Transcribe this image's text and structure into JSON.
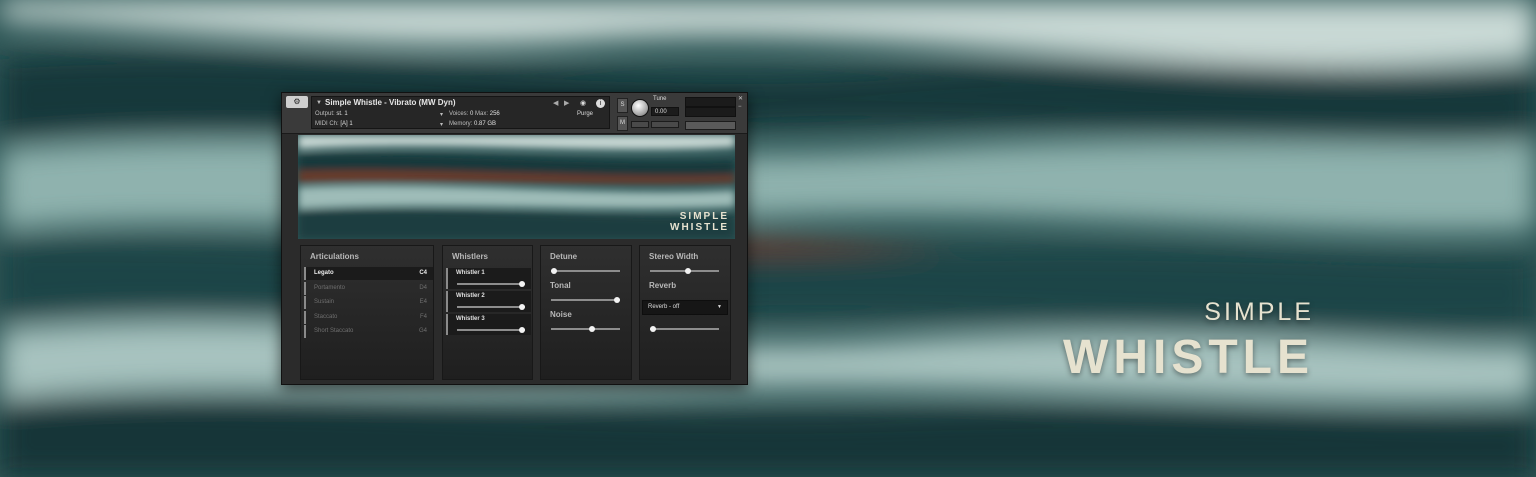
{
  "hero": {
    "line1": "SIMPLE",
    "line2": "WHISTLE"
  },
  "header": {
    "instrument_name": "Simple Whistle - Vibrato (MW Dyn)",
    "output_label": "Output:",
    "output_value": "st. 1",
    "midi_label": "MIDI Ch:",
    "midi_port": "[A]",
    "midi_value": "1",
    "voices_label": "Voices:",
    "voices_value": "0",
    "max_label": "Max:",
    "max_value": "256",
    "memory_label": "Memory:",
    "memory_value": "0.87 GB",
    "purge_label": "Purge",
    "tune_label": "Tune",
    "tune_value": "0.00",
    "s_label": "S",
    "m_label": "M"
  },
  "banner": {
    "line1": "SIMPLE",
    "line2": "WHISTLE"
  },
  "articulations": {
    "title": "Articulations",
    "items": [
      {
        "label": "Legato",
        "key": "C4",
        "selected": true
      },
      {
        "label": "Portamento",
        "key": "D4",
        "selected": false
      },
      {
        "label": "Sustain",
        "key": "E4",
        "selected": false
      },
      {
        "label": "Staccato",
        "key": "F4",
        "selected": false
      },
      {
        "label": "Short Staccato",
        "key": "G4",
        "selected": false
      }
    ]
  },
  "whistlers": {
    "title": "Whistlers",
    "items": [
      {
        "label": "Whistler 1",
        "value": 1.0
      },
      {
        "label": "Whistler 2",
        "value": 1.0
      },
      {
        "label": "Whistler 3",
        "value": 1.0
      }
    ]
  },
  "tone": {
    "detune_label": "Detune",
    "detune_value": 0.0,
    "tonal_label": "Tonal",
    "tonal_value": 1.0,
    "noise_label": "Noise",
    "noise_value": 0.6
  },
  "space": {
    "stereo_label": "Stereo Width",
    "stereo_value": 0.55,
    "reverb_label": "Reverb",
    "reverb_select": "Reverb - off",
    "reverb_value": 0.0
  },
  "colors": {
    "accent": "#e6e2cf",
    "panel": "#2b2b2b",
    "teal": "#2f6466",
    "rust": "#6b3a2a"
  }
}
